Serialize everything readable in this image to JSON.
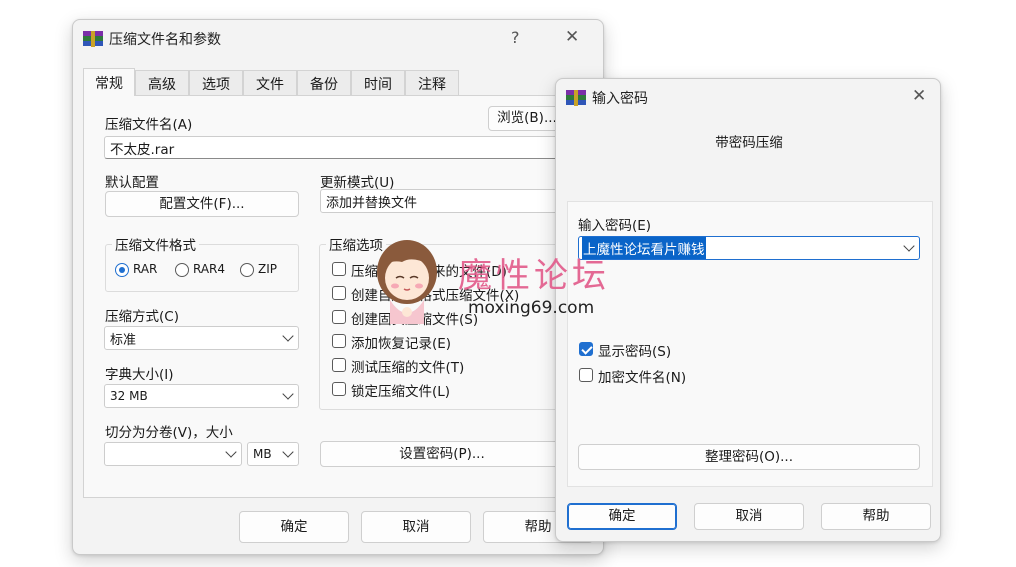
{
  "main_dialog": {
    "title": "压缩文件名和参数",
    "help_glyph": "?",
    "close_glyph": "✕",
    "tabs": [
      "常规",
      "高级",
      "选项",
      "文件",
      "备份",
      "时间",
      "注释"
    ],
    "archive_name_label": "压缩文件名(A)",
    "browse_button": "浏览(B)...",
    "archive_name_value": "不太皮.rar",
    "default_profile_label": "默认配置",
    "profiles_button": "配置文件(F)...",
    "update_mode_label": "更新模式(U)",
    "update_mode_value": "添加并替换文件",
    "archive_format_label": "压缩文件格式",
    "formats": [
      "RAR",
      "RAR4",
      "ZIP"
    ],
    "selected_format": "RAR",
    "compression_method_label": "压缩方式(C)",
    "compression_method_value": "标准",
    "dictionary_size_label": "字典大小(I)",
    "dictionary_size_value": "32 MB",
    "split_label": "切分为分卷(V)，大小",
    "split_value": "",
    "split_unit": "MB",
    "options_label": "压缩选项",
    "options": [
      {
        "label": "压缩后删除原来的文件(D)",
        "checked": false
      },
      {
        "label": "创建自解压格式压缩文件(X)",
        "checked": false
      },
      {
        "label": "创建固实压缩文件(S)",
        "checked": false
      },
      {
        "label": "添加恢复记录(E)",
        "checked": false
      },
      {
        "label": "测试压缩的文件(T)",
        "checked": false
      },
      {
        "label": "锁定压缩文件(L)",
        "checked": false
      }
    ],
    "set_password_button": "设置密码(P)...",
    "ok_button": "确定",
    "cancel_button": "取消",
    "help_button": "帮助"
  },
  "password_dialog": {
    "title": "输入密码",
    "close_glyph": "✕",
    "heading": "带密码压缩",
    "password_label": "输入密码(E)",
    "password_value": "上魔性论坛看片赚钱",
    "show_password_label": "显示密码(S)",
    "show_password_checked": true,
    "encrypt_names_label": "加密文件名(N)",
    "encrypt_names_checked": false,
    "organize_button": "整理密码(O)...",
    "ok_button": "确定",
    "cancel_button": "取消",
    "help_button": "帮助"
  },
  "watermark": {
    "text": "魔性论坛",
    "url": "moxing69.com"
  },
  "colors": {
    "accent": "#1f6fd0",
    "selection": "#0a64c8",
    "watermark": "#e25a8a"
  }
}
